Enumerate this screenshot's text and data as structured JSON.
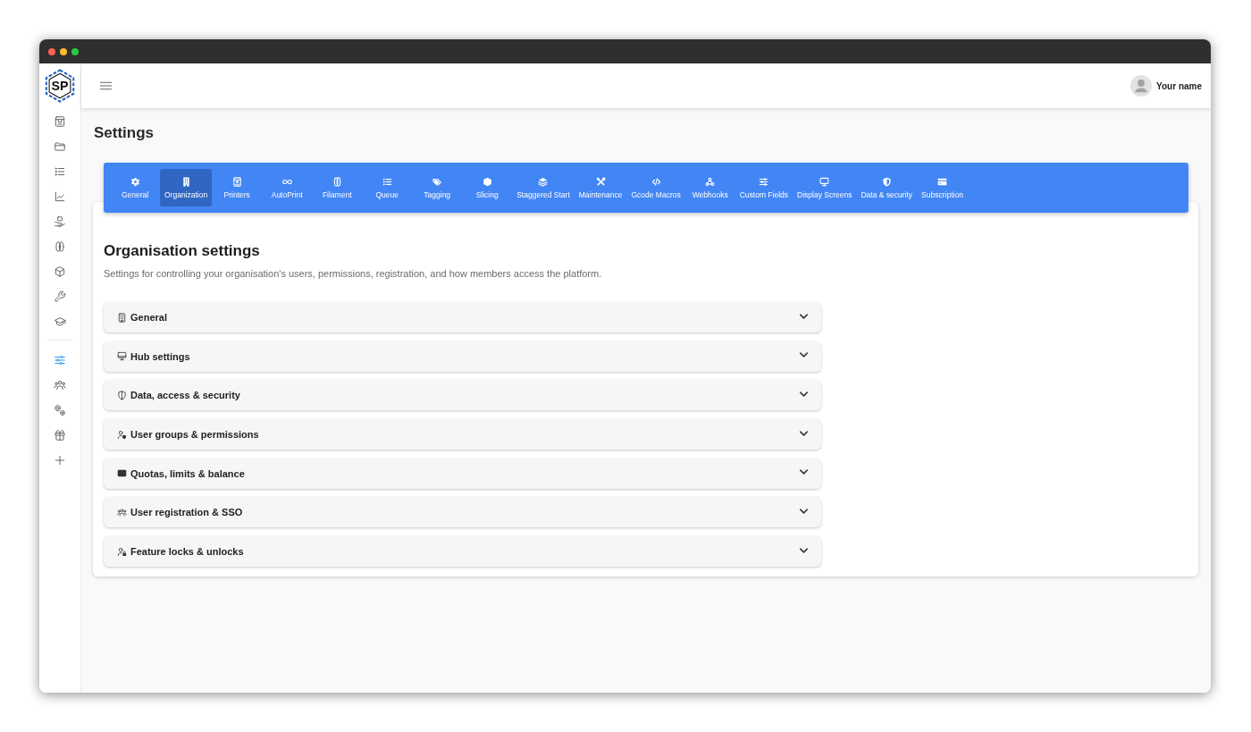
{
  "logo": {
    "text": "SP"
  },
  "sidebar": {
    "sections": [
      {
        "items": [
          {
            "selected": false
          },
          {
            "selected": false
          },
          {
            "selected": false
          },
          {
            "selected": false
          },
          {
            "selected": false
          },
          {
            "selected": false
          },
          {
            "selected": false
          },
          {
            "selected": false
          },
          {
            "selected": false
          }
        ]
      },
      {
        "items": [
          {
            "selected": true
          },
          {
            "selected": false
          },
          {
            "selected": false
          },
          {
            "selected": false
          },
          {
            "selected": false
          }
        ]
      }
    ]
  },
  "header": {
    "user_name": "Your name"
  },
  "page_title": "Settings",
  "tabs": [
    {
      "label": "General",
      "selected": false
    },
    {
      "label": "Organization",
      "selected": true
    },
    {
      "label": "Printers",
      "selected": false
    },
    {
      "label": "AutoPrint",
      "selected": false
    },
    {
      "label": "Filament",
      "selected": false
    },
    {
      "label": "Queue",
      "selected": false
    },
    {
      "label": "Tagging",
      "selected": false
    },
    {
      "label": "Slicing",
      "selected": false
    },
    {
      "label": "Staggered Start",
      "selected": false
    },
    {
      "label": "Maintenance",
      "selected": false
    },
    {
      "label": "Gcode Macros",
      "selected": false
    },
    {
      "label": "Webhooks",
      "selected": false
    },
    {
      "label": "Custom Fields",
      "selected": false
    },
    {
      "label": "Display Screens",
      "selected": false
    },
    {
      "label": "Data & security",
      "selected": false
    },
    {
      "label": "Subscription",
      "selected": false
    }
  ],
  "panel": {
    "title": "Organisation settings",
    "description": "Settings for controlling your organisation's users, permissions, registration, and how members access the platform.",
    "sections": [
      {
        "label": "General",
        "expanded": false
      },
      {
        "label": "Hub settings",
        "expanded": false
      },
      {
        "label": "Data, access & security",
        "expanded": false
      },
      {
        "label": "User groups & permissions",
        "expanded": false
      },
      {
        "label": "Quotas, limits & balance",
        "expanded": false
      },
      {
        "label": "User registration & SSO",
        "expanded": false
      },
      {
        "label": "Feature locks & unlocks",
        "expanded": false
      }
    ]
  }
}
